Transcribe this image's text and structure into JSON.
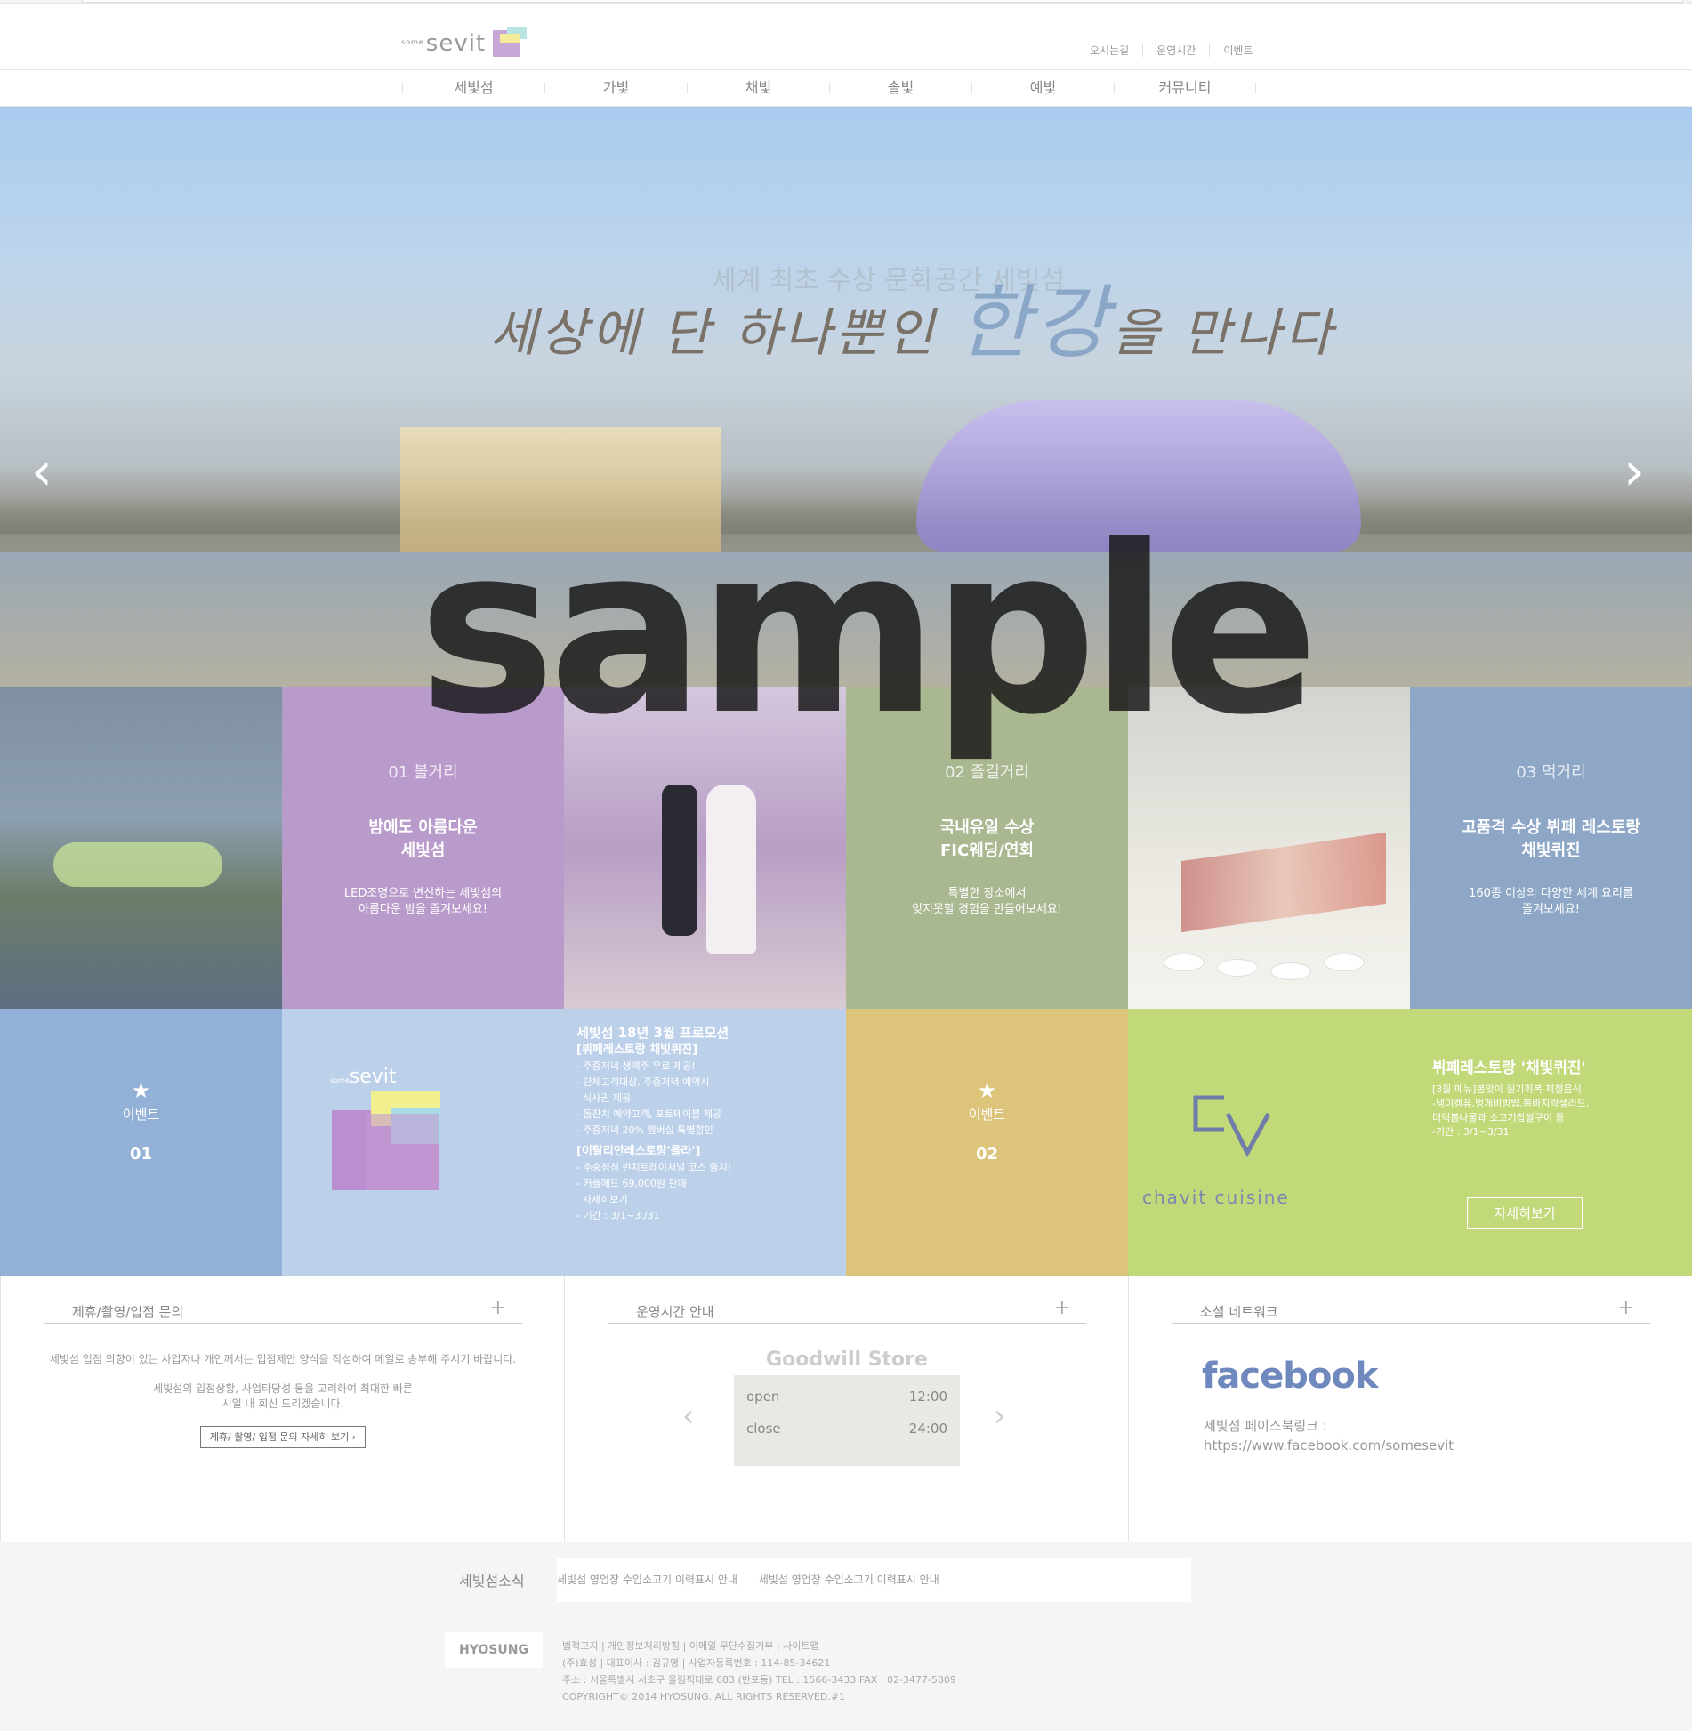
{
  "header": {
    "logo_small": "some",
    "logo_text": "sevit",
    "links": [
      "오시는길",
      "운영시간",
      "이벤트"
    ]
  },
  "nav": [
    "세빛섬",
    "가빛",
    "채빛",
    "솔빛",
    "예빛",
    "커뮤니티"
  ],
  "hero": {
    "title_pre": "세상에 단 하나뿐인 ",
    "title_big": "한강",
    "title_post": "을 만나다",
    "sub": "세계 최초 수상 문화공간 세빛섬",
    "watermark": "sample"
  },
  "features": [
    {
      "num": "01 볼거리",
      "title1": "밤에도 아름다운",
      "title2": "세빛섬",
      "desc1": "LED조명으로 변신하는 세빛섬의",
      "desc2": "아름다운 밤을 즐겨보세요!"
    },
    {
      "num": "02 즐길거리",
      "title1": "국내유일 수상",
      "title2": "FIC웨딩/연회",
      "desc1": "특별한 장소에서",
      "desc2": "잊지못할 경험을 만들어보세요!"
    },
    {
      "num": "03 먹거리",
      "title1": "고품격 수상 뷔페 레스토랑",
      "title2": "채빛퀴진",
      "desc1": "160종 이상의 다양한 세계 요리를",
      "desc2": "즐겨보세요!"
    }
  ],
  "events": [
    {
      "label": "이벤트",
      "no": "01"
    },
    {
      "label": "이벤트",
      "no": "02"
    }
  ],
  "promo": {
    "title": "세빛섬 18년 3월 프로모션",
    "sec1": "[뷔페레스토랑 채빛퀴진]",
    "sec1_items": [
      "- 주중저녁 생맥주 무료 제공!",
      "- 단체고객대상, 주중저녁 예약시",
      "  식사권 제공",
      "- 돌잔치 예약고객, 포토테이블 제공",
      "- 주중저녁 20% 멤버십 특별할인"
    ],
    "sec2": "[이탈리안레스토랑'올라']",
    "sec2_items": [
      "- 주중점심 런치트레이서널 코스 출시!",
      "- 커플메드 69,000원 판매",
      "  자세히보기",
      "- 기간 : 3/1~3./31"
    ]
  },
  "chavit": {
    "brand": "chavit cuisine",
    "title": "뷔페레스토랑 '채빛퀴진'",
    "lines": [
      "[3월 메뉴]봄맞이 원기회복 제철음식",
      "-냉이캠퓨,멍게비빔밥,봄바지락샐러드,",
      "더덕봄나물과 소고기찹쌀구이 등",
      "-기간 : 3/1~3/31"
    ],
    "button": "자세히보기"
  },
  "inquiry": {
    "title": "제휴/촬영/입점 문의",
    "p1": "세빛섬 입점 의향이 있는 사업자나 개인께서는 입점제안 양식을 작성하여 메일로 송부해 주시기 바랍니다.",
    "p2a": "세빛섬의 입점상황, 사업타당성 등을 고려하여 최대한 빠른",
    "p2b": "시일 내 회신 드리겠습니다.",
    "link": "제휴/ 촬영/ 입점 문의 자세히 보기  ›"
  },
  "hours": {
    "title": "운영시간 안내",
    "store": "Goodwill Store",
    "open_label": "open",
    "open_time": "12:00",
    "close_label": "close",
    "close_time": "24:00"
  },
  "social": {
    "title": "소셜 네트워크",
    "brand": "facebook",
    "label": "세빛섬 페이스북링크 :",
    "url": "https://www.facebook.com/somesevit"
  },
  "news": {
    "label": "세빛섬소식",
    "items": [
      "세빛섬 영업장 수입소고기 이력표시 안내",
      "세빛섬 영업장 수입소고기 이력표시 안내"
    ]
  },
  "footer": {
    "brand": "HYOSUNG",
    "l1": "법적고지 | 개인정보처리방침 | 이메일 무단수집거부 | 사이트맵",
    "l2": "(주)효성 | 대표이사 : 김규영 | 사업자등록번호 : 114-85-34621",
    "l3": "주소 : 서울특별시 서초구 올림픽대로 683 (반포동) TEL : 1566-3433 FAX : 02-3477-5809",
    "l4": "COPYRIGHT© 2014 HYOSUNG. ALL RIGHTS RESERVED.#1"
  },
  "colors": {
    "purple": "#b99bcb",
    "green": "#a9b891",
    "blue": "#8ea7c6",
    "lightblue": "#bcd0ea",
    "eventblue": "#93b1d7",
    "gold": "#dcc47a",
    "lime": "#c2d97a"
  }
}
